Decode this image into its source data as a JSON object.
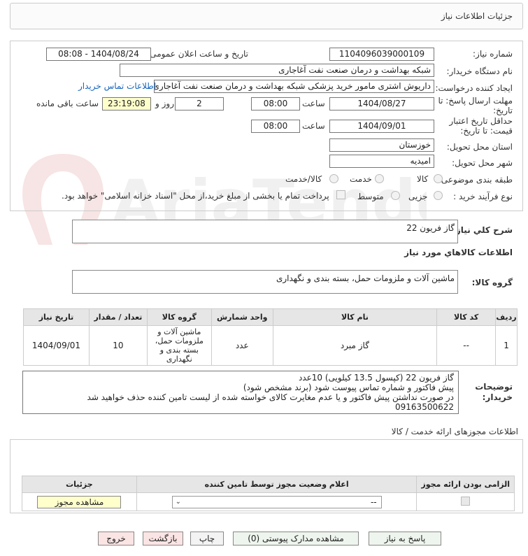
{
  "page_title": "جزئیات اطلاعات نیاز",
  "form": {
    "need_number_label": "شماره نیاز:",
    "need_number": "1104096039000109",
    "announce_label": "تاریخ و ساعت اعلان عمومی:",
    "announce_value": "1404/08/24 - 08:08",
    "buyer_org_label": "نام دستگاه خریدار:",
    "buyer_org": "شبکه بهداشت و درمان صنعت نفت آغاجاری",
    "requester_label": "ایجاد کننده درخواست:",
    "requester": "داریوش اشتری مامور خرید پزشکی شبکه بهداشت و درمان صنعت نفت آغاجاری",
    "contact_link": "اطلاعات تماس خریدار",
    "deadline_label": "مهلت ارسال پاسخ: تا تاریخ:",
    "deadline_date": "1404/08/27",
    "time_label": "ساعت",
    "deadline_time": "08:00",
    "days": "2",
    "days_label": "روز و",
    "remaining_time": "23:19:08",
    "remaining_label": "ساعت باقی مانده",
    "min_validity_label": "حداقل تاریخ اعتبار قیمت: تا تاریخ:",
    "validity_date": "1404/09/01",
    "validity_time": "08:00",
    "province_label": "استان محل تحویل:",
    "province": "خوزستان",
    "city_label": "شهر محل تحویل:",
    "city": "امیدیه",
    "category_label": "طبقه بندی موضوعی:",
    "category_options": [
      "کالا",
      "خدمت",
      "کالا/خدمت"
    ],
    "process_label": "نوع فرآیند خرید :",
    "process_options": [
      "جزیی",
      "متوسط"
    ],
    "payment_note": "پرداخت تمام یا بخشی از مبلغ خرید،از محل \"اسناد خزانه اسلامی\" خواهد بود."
  },
  "summary": {
    "label": "شرح کلي نياز:",
    "value": "گاز فریون 22"
  },
  "goods": {
    "section_title": "اطلاعات کالاهاي مورد نياز",
    "group_label": "گروه کالا:",
    "group_value": "ماشین آلات و ملزومات حمل، بسته بندی و نگهداری",
    "headers": [
      "ردیف",
      "کد کالا",
      "نام کالا",
      "واحد شمارش",
      "گروه کالا",
      "تعداد / مقدار",
      "تاریخ نیاز"
    ],
    "rows": [
      {
        "row": "1",
        "code": "--",
        "name": "گاز مبرد",
        "unit": "عدد",
        "group": "ماشین آلات و ملزومات حمل، بسته بندی و نگهداری",
        "qty": "10",
        "date": "1404/09/01"
      }
    ]
  },
  "buyer_notes": {
    "label": "توضیحات خریدار:",
    "lines": [
      "گاز فریون 22 (کپسول 13.5 کیلویی) 10عدد",
      "پیش فاکتور و شماره تماس پیوست شود (برند مشخص شود)",
      "در صورت نداشتن پیش فاکتور و یا عدم مغایرت کالای خواسته شده از لیست تامین کننده حذف خواهید شد",
      "09163500622"
    ]
  },
  "permits": {
    "section_title": "اطلاعات مجوزهای ارائه خدمت / کالا",
    "headers": [
      "الزامی بودن ارائه مجوز",
      "اعلام وضعیت مجوز توسط تامین کننده",
      "جزئیات"
    ],
    "select_value": "--",
    "view_button": "مشاهده مجوز"
  },
  "buttons": {
    "reply": "پاسخ به نیاز",
    "attachments": "مشاهده مدارک پیوستی (0)",
    "print": "چاپ",
    "back": "بازگشت",
    "exit": "خروج"
  },
  "colors": {
    "highlight": "#ffffcc",
    "link": "#1565c0",
    "header_bg": "#e6e6e6"
  }
}
